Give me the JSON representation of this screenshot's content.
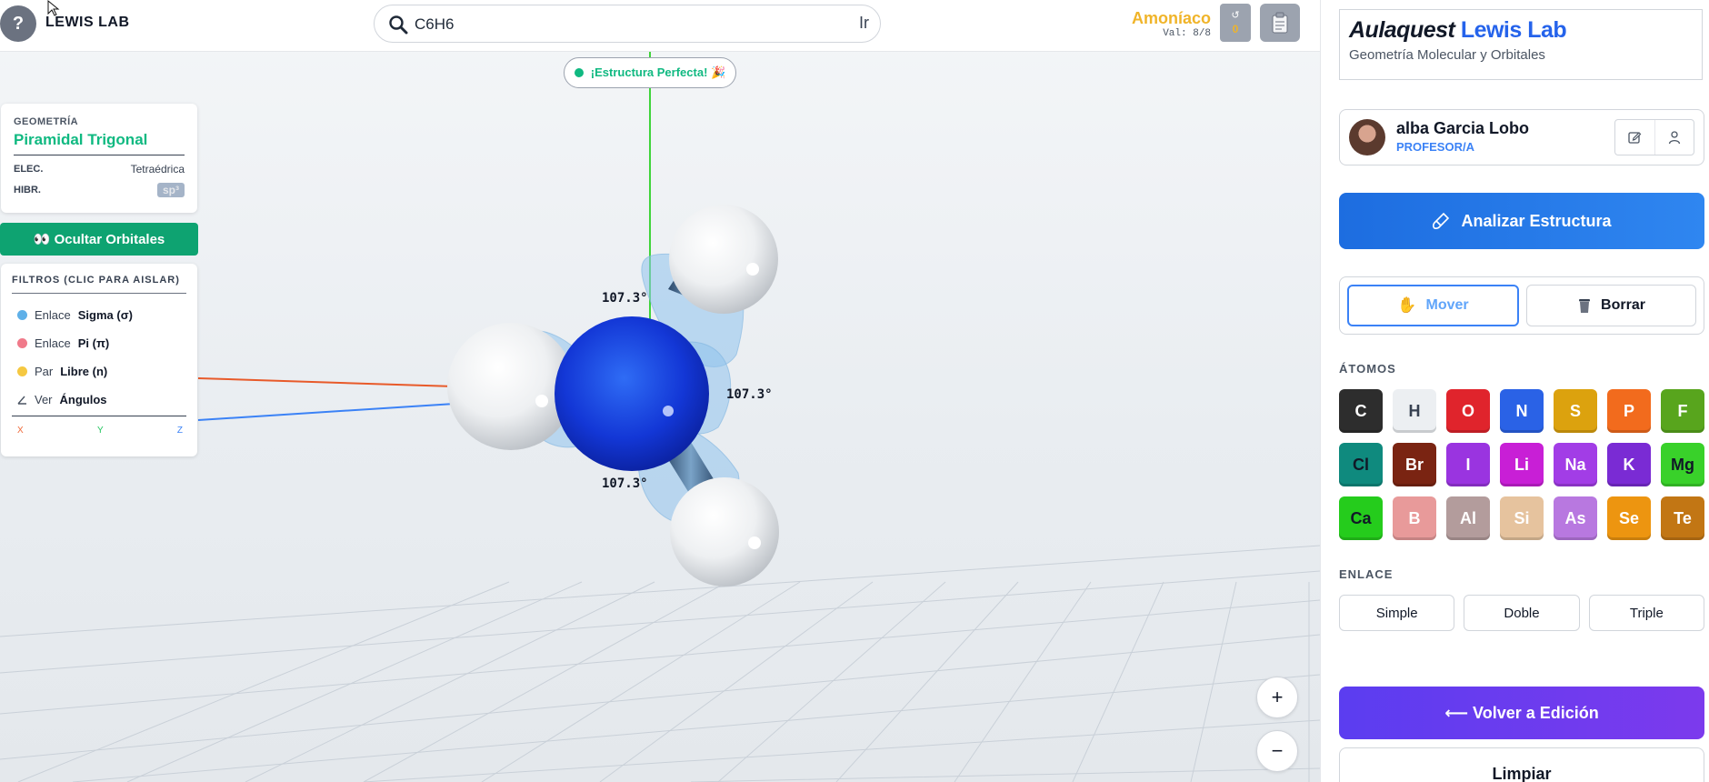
{
  "header": {
    "help_label": "?",
    "app_name": "LEWIS LAB",
    "search_value": "C6H6",
    "search_go": "Ir",
    "molecule_name": "Amoníaco",
    "molecule_valence": "Val: 8/8",
    "counter_value": "0"
  },
  "status": {
    "text": "¡Estructura Perfecta! 🎉"
  },
  "geometry": {
    "label": "GEOMETRÍA",
    "value": "Piramidal Trigonal",
    "elec_label": "ELEC.",
    "elec_value": "Tetraédrica",
    "hybr_label": "HIBR.",
    "hybr_value": "sp³"
  },
  "orbitals_button": "👀 Ocultar Orbitales",
  "filters": {
    "title": "FILTROS (CLIC PARA AISLAR)",
    "items": [
      {
        "prefix": "Enlace",
        "bold": "Sigma (σ)",
        "color": "#5fb0e8"
      },
      {
        "prefix": "Enlace",
        "bold": "Pi (π)",
        "color": "#f07a8a"
      },
      {
        "prefix": "Par",
        "bold": "Libre (n)",
        "color": "#f5c842"
      },
      {
        "prefix": "Ver",
        "bold": "Ángulos",
        "color": "#9ca3af"
      }
    ],
    "axes": [
      {
        "label": "X",
        "color": "#ef6a3a"
      },
      {
        "label": "Y",
        "color": "#22c55e"
      },
      {
        "label": "Z",
        "color": "#3b82f6"
      }
    ]
  },
  "angles": [
    "107.3°",
    "107.3°",
    "107.3°"
  ],
  "zoom": {
    "in": "+",
    "out": "−"
  },
  "sidebar": {
    "brand_italic": "Aulaquest",
    "brand_accent": "Lewis Lab",
    "brand_subtitle": "Geometría Molecular y Orbitales",
    "user_name": "alba Garcia Lobo",
    "user_role": "PROFESOR/A",
    "analyze_label": "Analizar Estructura",
    "mode_move": "Mover",
    "mode_delete": "Borrar",
    "atoms_label": "ÁTOMOS",
    "atoms": [
      {
        "symbol": "C",
        "color": "#2d2d2d",
        "text": "#ffffff"
      },
      {
        "symbol": "H",
        "color": "#eceff2",
        "text": "#374151"
      },
      {
        "symbol": "O",
        "color": "#e0242c",
        "text": "#ffffff"
      },
      {
        "symbol": "N",
        "color": "#2a62e6",
        "text": "#ffffff"
      },
      {
        "symbol": "S",
        "color": "#dca20e",
        "text": "#ffffff"
      },
      {
        "symbol": "P",
        "color": "#f26b1d",
        "text": "#ffffff"
      },
      {
        "symbol": "F",
        "color": "#58a51d",
        "text": "#ffffff"
      },
      {
        "symbol": "Cl",
        "color": "#0f8a7e",
        "text": "#111827"
      },
      {
        "symbol": "Br",
        "color": "#7a2412",
        "text": "#ffffff"
      },
      {
        "symbol": "I",
        "color": "#9a34e0",
        "text": "#ffffff"
      },
      {
        "symbol": "Li",
        "color": "#c81fd6",
        "text": "#ffffff"
      },
      {
        "symbol": "Na",
        "color": "#a23de6",
        "text": "#ffffff"
      },
      {
        "symbol": "K",
        "color": "#7a2bd4",
        "text": "#ffffff"
      },
      {
        "symbol": "Mg",
        "color": "#39d12a",
        "text": "#111827"
      },
      {
        "symbol": "Ca",
        "color": "#25cc1c",
        "text": "#111827"
      },
      {
        "symbol": "B",
        "color": "#e89a9a",
        "text": "#ffffff"
      },
      {
        "symbol": "Al",
        "color": "#b39c9c",
        "text": "#ffffff"
      },
      {
        "symbol": "Si",
        "color": "#e6c39e",
        "text": "#ffffff"
      },
      {
        "symbol": "As",
        "color": "#b878e0",
        "text": "#ffffff"
      },
      {
        "symbol": "Se",
        "color": "#ed9510",
        "text": "#ffffff"
      },
      {
        "symbol": "Te",
        "color": "#c27614",
        "text": "#ffffff"
      }
    ],
    "bond_label": "ENLACE",
    "bonds": [
      "Simple",
      "Doble",
      "Triple"
    ],
    "back_label": "⟵ Volver a Edición",
    "clear_label": "Limpiar"
  }
}
